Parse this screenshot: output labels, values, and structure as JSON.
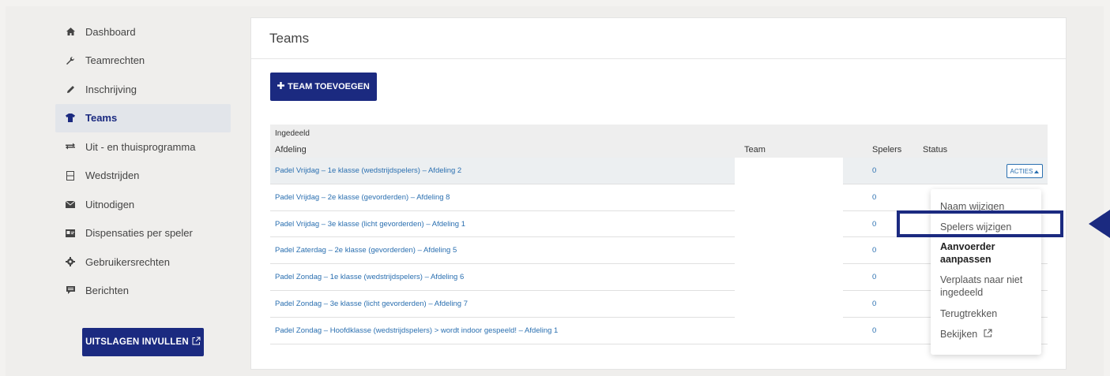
{
  "sidebar": {
    "items": [
      {
        "label": "Dashboard",
        "icon": "home-icon"
      },
      {
        "label": "Teamrechten",
        "icon": "wrench-icon"
      },
      {
        "label": "Inschrijving",
        "icon": "pencil-icon"
      },
      {
        "label": "Teams",
        "icon": "shirt-icon",
        "active": true
      },
      {
        "label": "Uit - en thuisprogramma",
        "icon": "exchange-icon"
      },
      {
        "label": "Wedstrijden",
        "icon": "columns-icon"
      },
      {
        "label": "Uitnodigen",
        "icon": "envelope-icon"
      },
      {
        "label": "Dispensaties per speler",
        "icon": "id-card-icon"
      },
      {
        "label": "Gebruikersrechten",
        "icon": "gear-icon"
      },
      {
        "label": "Berichten",
        "icon": "comment-icon"
      }
    ],
    "uitslagen_label": "UITSLAGEN INVULLEN"
  },
  "main": {
    "title": "Teams",
    "add_button_label": "TEAM TOEVOEGEN",
    "group_label": "Ingedeeld",
    "columns": {
      "afdeling": "Afdeling",
      "team": "Team",
      "spelers": "Spelers",
      "status": "Status"
    },
    "rows": [
      {
        "afdeling": "Padel Vrijdag – 1e klasse (wedstrijdspelers) – Afdeling 2",
        "spelers": "0"
      },
      {
        "afdeling": "Padel Vrijdag – 2e klasse (gevorderden) – Afdeling 8",
        "spelers": "0"
      },
      {
        "afdeling": "Padel Vrijdag – 3e klasse (licht gevorderden) – Afdeling 1",
        "spelers": "0"
      },
      {
        "afdeling": "Padel Zaterdag – 2e klasse (gevorderden) – Afdeling 5",
        "spelers": "0"
      },
      {
        "afdeling": "Padel Zondag – 1e klasse (wedstrijdspelers) – Afdeling 6",
        "spelers": "0"
      },
      {
        "afdeling": "Padel Zondag – 3e klasse (licht gevorderden) – Afdeling 7",
        "spelers": "0"
      },
      {
        "afdeling": "Padel Zondag – Hoofdklasse (wedstrijdspelers) > wordt indoor gespeeld! – Afdeling 1",
        "spelers": "0"
      }
    ],
    "acties_label": "ACTIES"
  },
  "dropdown": {
    "items": [
      {
        "label": "Naam wijzigen"
      },
      {
        "label": "Spelers wijzigen"
      },
      {
        "label": "Aanvoerder aanpassen"
      },
      {
        "label": "Verplaats naar niet ingedeeld"
      },
      {
        "label": "Terugtrekken"
      },
      {
        "label": "Bekijken"
      }
    ]
  },
  "colors": {
    "primary": "#1b2a80",
    "link": "#2a6fb0"
  }
}
